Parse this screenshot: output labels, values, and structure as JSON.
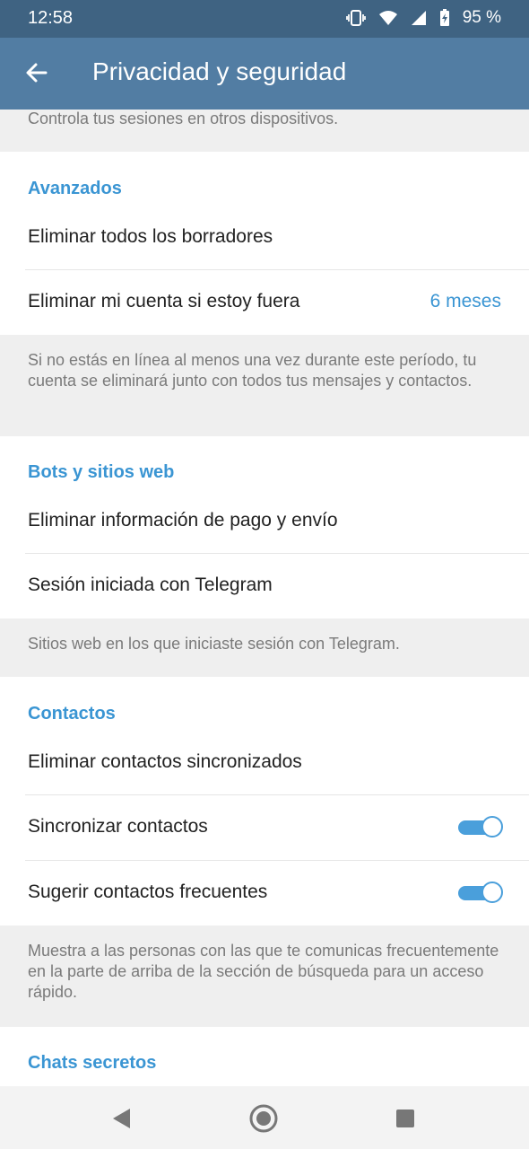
{
  "status": {
    "time": "12:58",
    "battery": "95 %"
  },
  "appbar": {
    "title": "Privacidad y seguridad"
  },
  "sections": {
    "top_note": "Controla tus sesiones en otros dispositivos.",
    "advanced": {
      "header": "Avanzados",
      "delete_drafts": "Eliminar todos los borradores",
      "delete_account": "Eliminar mi cuenta si estoy fuera",
      "delete_account_value": "6 meses",
      "note": "Si no estás en línea al menos una vez durante este período, tu cuenta se eliminará junto con todos tus mensajes y contactos."
    },
    "bots": {
      "header": "Bots y sitios web",
      "delete_payment": "Eliminar información de pago y envío",
      "telegram_login": "Sesión iniciada con Telegram",
      "note": "Sitios web en los que iniciaste sesión con Telegram."
    },
    "contacts": {
      "header": "Contactos",
      "delete_synced": "Eliminar contactos sincronizados",
      "sync": "Sincronizar contactos",
      "sync_enabled": true,
      "suggest": "Sugerir contactos frecuentes",
      "suggest_enabled": true,
      "note": "Muestra a las personas con las que te comunicas frecuentemente en la parte de arriba de la sección de búsqueda para un acceso rápido."
    },
    "secret": {
      "header": "Chats secretos"
    }
  },
  "icons": {
    "vibrate": "vibrate-icon",
    "wifi": "wifi-icon",
    "signal": "signal-icon",
    "battery": "battery-charging-icon",
    "back": "arrow-left-icon",
    "nav_back": "triangle-back-icon",
    "nav_home": "circle-home-icon",
    "nav_recents": "square-recents-icon"
  },
  "colors": {
    "statusbar": "#3f6382",
    "appbar": "#527da3",
    "accent": "#3a95d3",
    "toggle": "#4a9fdb"
  }
}
